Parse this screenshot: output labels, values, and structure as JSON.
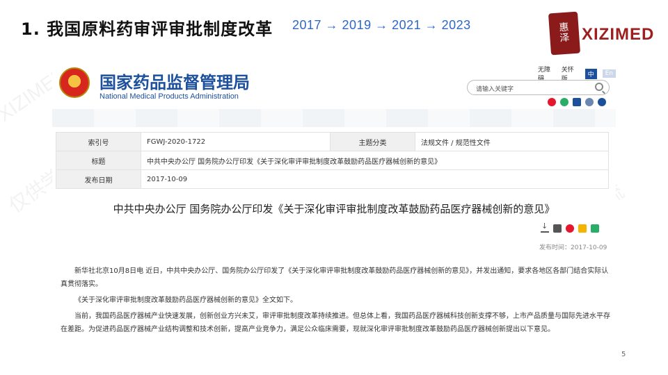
{
  "slide": {
    "title": "1. 我国原料药审评审批制度改革",
    "timeline": "2017 → 2019 → 2021 → 2023",
    "brand": "XIZIMED",
    "seal_text": [
      "惠",
      "泽"
    ],
    "page_number": "5"
  },
  "watermark": {
    "text_cn": "仅供学术交流",
    "text_en": "XIZIMED"
  },
  "site": {
    "name_cn": "国家药品监督管理局",
    "name_en": "National Medical Products Administration",
    "util_links": [
      "无障碍",
      "关怀版"
    ],
    "lang_active": "中",
    "lang_inactive": "En",
    "search_placeholder": "请输入关键字"
  },
  "meta": {
    "rows": [
      {
        "k1": "索引号",
        "v1": "FGWJ-2020-1722",
        "k2": "主题分类",
        "v2": "法规文件 / 规范性文件"
      },
      {
        "k1": "标题",
        "v1": "中共中央办公厅 国务院办公厅印发《关于深化审评审批制度改革鼓励药品医疗器械创新的意见》"
      },
      {
        "k1": "发布日期",
        "v1": "2017-10-09"
      }
    ]
  },
  "article": {
    "title": "中共中央办公厅 国务院办公厅印发《关于深化审评审批制度改革鼓励药品医疗器械创新的意见》",
    "pub_time": "发布时间：2017-10-09",
    "paragraphs": [
      "新华社北京10月8日电 近日，中共中央办公厅、国务院办公厅印发了《关于深化审评审批制度改革鼓励药品医疗器械创新的意见》，并发出通知，要求各地区各部门结合实际认真贯彻落实。",
      "《关于深化审评审批制度改革鼓励药品医疗器械创新的意见》全文如下。",
      "当前，我国药品医疗器械产业快速发展，创新创业方兴未艾，审评审批制度改革持续推进。但总体上看，我国药品医疗器械科技创新支撑不够，上市产品质量与国际先进水平存在差距。为促进药品医疗器械产业结构调整和技术创新，提高产业竞争力，满足公众临床需要，现就深化审评审批制度改革鼓励药品医疗器械创新提出以下意见。"
    ]
  },
  "colors": {
    "site_blue": "#1c4f9c",
    "timeline_blue": "#2e66c8",
    "brand_red": "#9c1e1e"
  }
}
